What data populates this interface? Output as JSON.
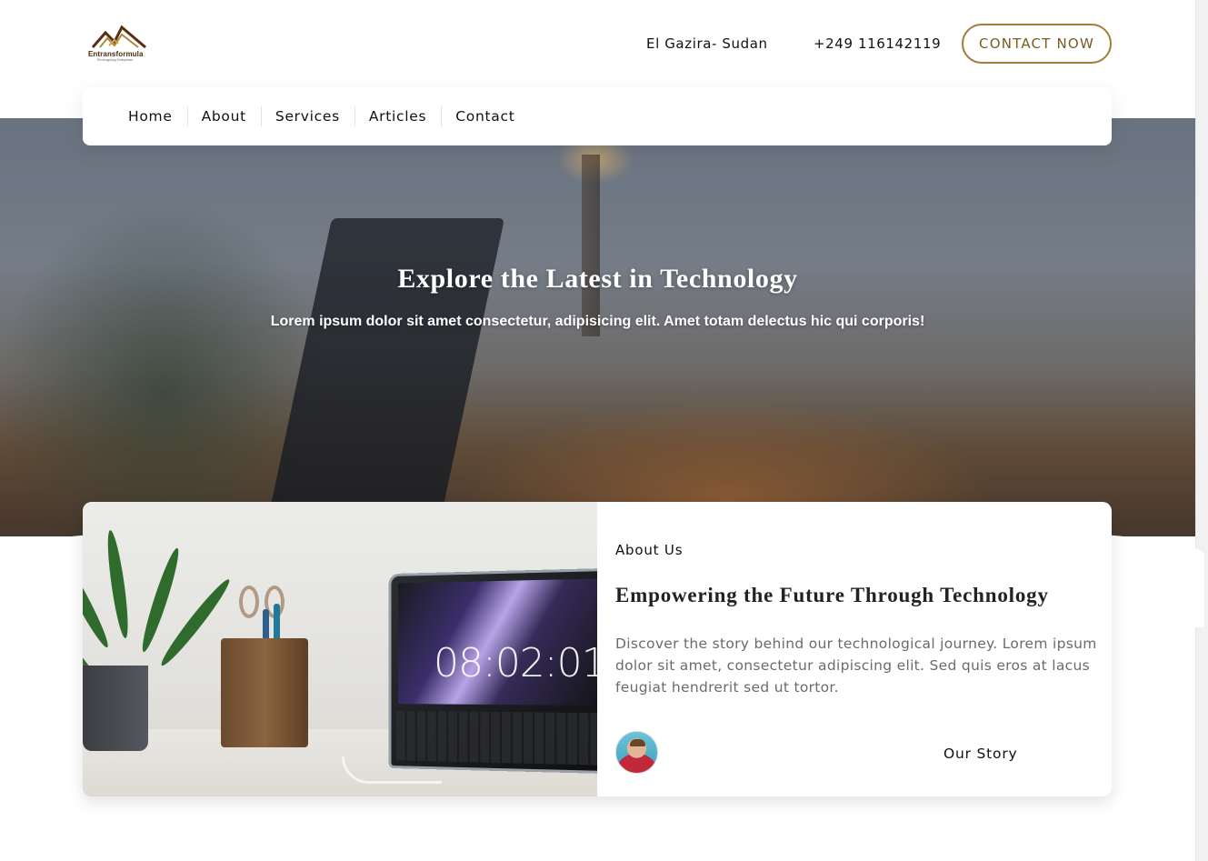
{
  "brand": {
    "name": "Entransformula",
    "tagline": "Re-imagining Enterprises",
    "accent_color": "#a07d38",
    "logo_icon": "mountain-logo-icon"
  },
  "header": {
    "location": "El Gazira- Sudan",
    "phone": "+249 116142119",
    "contact_label": "CONTACT NOW"
  },
  "nav": {
    "items": [
      {
        "label": "Home"
      },
      {
        "label": "About"
      },
      {
        "label": "Services"
      },
      {
        "label": "Articles"
      },
      {
        "label": "Contact"
      }
    ]
  },
  "hero": {
    "title": "Explore the Latest in Technology",
    "subtitle": "Lorem ipsum dolor sit amet consectetur, adipisicing elit. Amet totam delectus hic qui corporis!"
  },
  "about": {
    "eyebrow": "About Us",
    "title": "Empowering the Future Through Technology",
    "text": "Discover the story behind our technological journey. Lorem ipsum dolor sit amet, consectetur adipiscing elit. Sed quis eros at lacus feugiat hendrerit sed ut tortor.",
    "clock_reading": "08:02:01",
    "link_label": "Our Story"
  }
}
